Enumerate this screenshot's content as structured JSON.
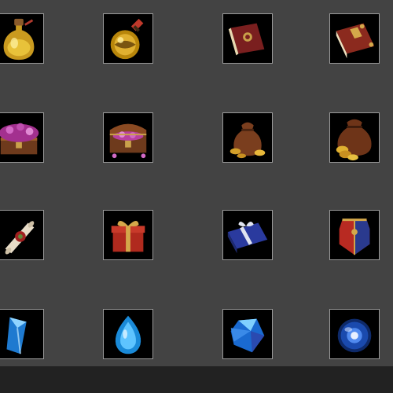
{
  "grid": {
    "items": [
      {
        "name": "yellow-potion-bottle-icon"
      },
      {
        "name": "ornate-gold-potion-icon"
      },
      {
        "name": "closed-spellbook-icon"
      },
      {
        "name": "ornate-tome-icon"
      },
      {
        "name": "open-gem-chest-icon"
      },
      {
        "name": "gem-treasure-chest-icon"
      },
      {
        "name": "coin-sack-icon"
      },
      {
        "name": "large-coin-sack-icon"
      },
      {
        "name": "sealed-scroll-icon"
      },
      {
        "name": "red-gift-box-icon"
      },
      {
        "name": "blue-gift-box-icon"
      },
      {
        "name": "crest-shield-icon"
      },
      {
        "name": "ice-crystal-shard-icon"
      },
      {
        "name": "blue-teardrop-gem-icon"
      },
      {
        "name": "blue-faceted-crystal-icon"
      },
      {
        "name": "glowing-blue-orb-icon"
      }
    ]
  },
  "colors": {
    "background": "#434343",
    "tile": "#000000",
    "tile_border": "#9a9a9a",
    "bottom_bar": "#222222"
  }
}
